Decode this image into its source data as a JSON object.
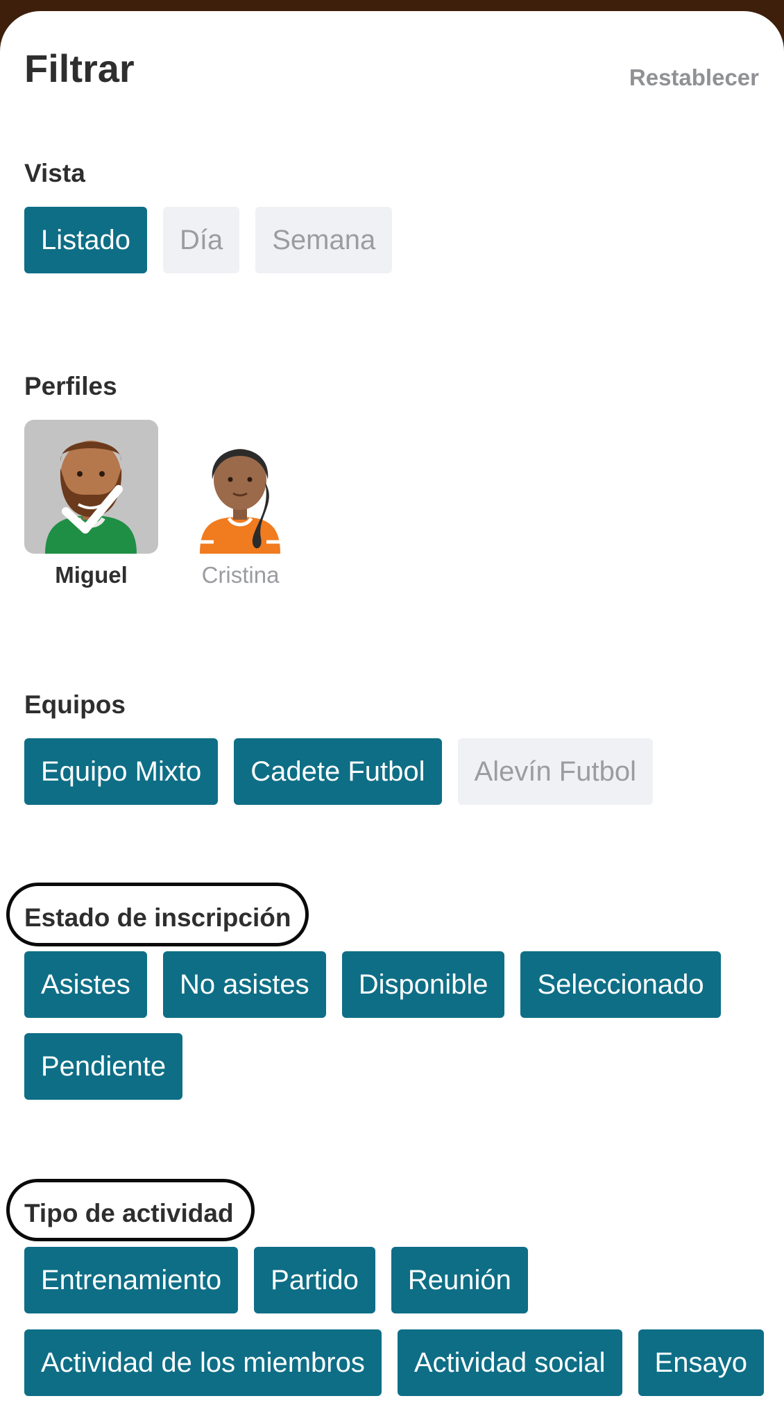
{
  "header": {
    "title": "Filtrar",
    "reset_label": "Restablecer"
  },
  "vista": {
    "label": "Vista",
    "options": [
      {
        "label": "Listado",
        "selected": true
      },
      {
        "label": "Día",
        "selected": false
      },
      {
        "label": "Semana",
        "selected": false
      }
    ]
  },
  "perfiles": {
    "label": "Perfiles",
    "profiles": [
      {
        "name": "Miguel",
        "selected": true,
        "icon": "avatar-bearded-man-green-shirt-icon"
      },
      {
        "name": "Cristina",
        "selected": false,
        "icon": "avatar-woman-orange-shirt-icon"
      }
    ]
  },
  "equipos": {
    "label": "Equipos",
    "options": [
      {
        "label": "Equipo Mixto",
        "selected": true
      },
      {
        "label": "Cadete Futbol",
        "selected": true
      },
      {
        "label": "Alevín Futbol",
        "selected": false
      }
    ]
  },
  "estado": {
    "label": "Estado de inscripción",
    "options": [
      {
        "label": "Asistes",
        "selected": true
      },
      {
        "label": "No asistes",
        "selected": true
      },
      {
        "label": "Disponible",
        "selected": true
      },
      {
        "label": "Seleccionado",
        "selected": true
      },
      {
        "label": "Pendiente",
        "selected": true
      }
    ]
  },
  "tipo": {
    "label": "Tipo de actividad",
    "options": [
      {
        "label": "Entrenamiento",
        "selected": true
      },
      {
        "label": "Partido",
        "selected": true
      },
      {
        "label": "Reunión",
        "selected": true
      },
      {
        "label": "Actividad de los miembros",
        "selected": true
      },
      {
        "label": "Actividad social",
        "selected": true
      },
      {
        "label": "Ensayo",
        "selected": true
      }
    ]
  },
  "colors": {
    "accent": "#0e6e86",
    "chip_off_bg": "#eff1f4",
    "chip_off_text": "#9a9ca0",
    "annotation_ring": "#0a0a0a"
  }
}
